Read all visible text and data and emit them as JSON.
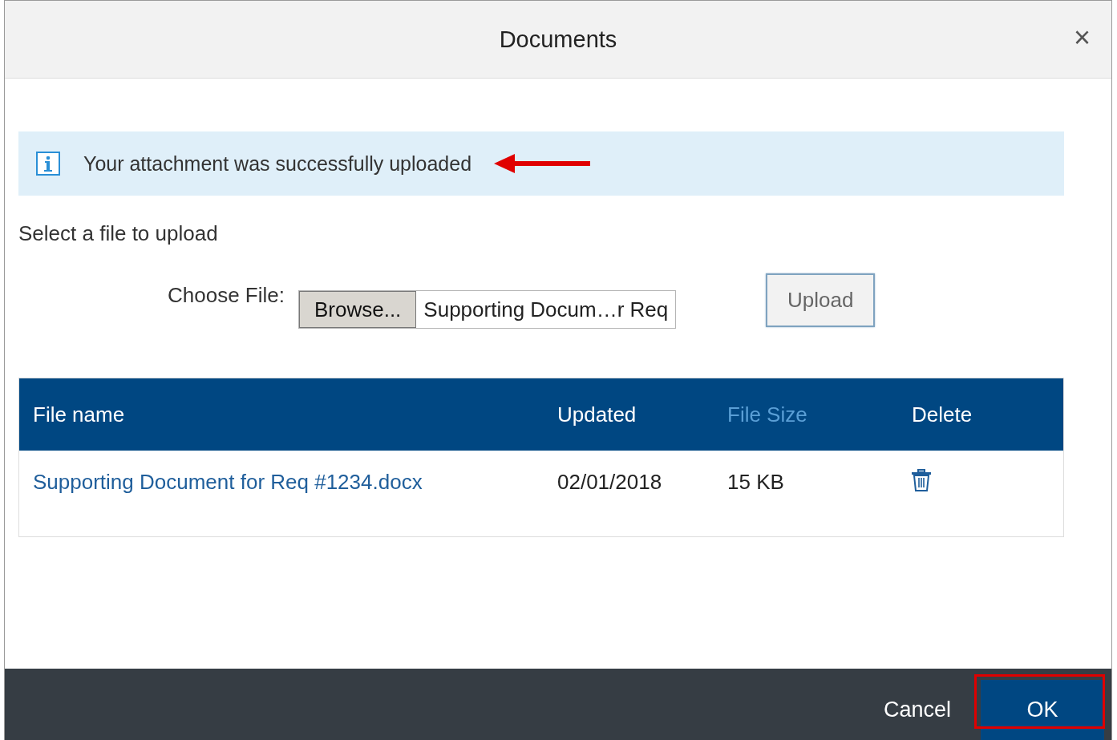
{
  "dialog": {
    "title": "Documents",
    "close": "×"
  },
  "message": {
    "text": "Your attachment was successfully uploaded",
    "annotated": true
  },
  "upload": {
    "heading": "Select a file to upload",
    "label": "Choose File:",
    "browse": "Browse...",
    "file_value": "Supporting Docum…r Req",
    "upload_button": "Upload"
  },
  "table": {
    "columns": [
      {
        "label": "File name",
        "faded": false
      },
      {
        "label": "Updated",
        "faded": false
      },
      {
        "label": "File Size",
        "faded": true
      },
      {
        "label": "Delete",
        "faded": false
      }
    ],
    "rows": [
      {
        "file_name": "Supporting Document for Req #1234.docx",
        "updated": "02/01/2018",
        "size": "15 KB"
      }
    ]
  },
  "footer": {
    "buttons": [
      {
        "label": "Cancel",
        "kind": "plain",
        "highlighted": false
      },
      {
        "label": "OK",
        "kind": "primary",
        "highlighted": true
      }
    ]
  }
}
